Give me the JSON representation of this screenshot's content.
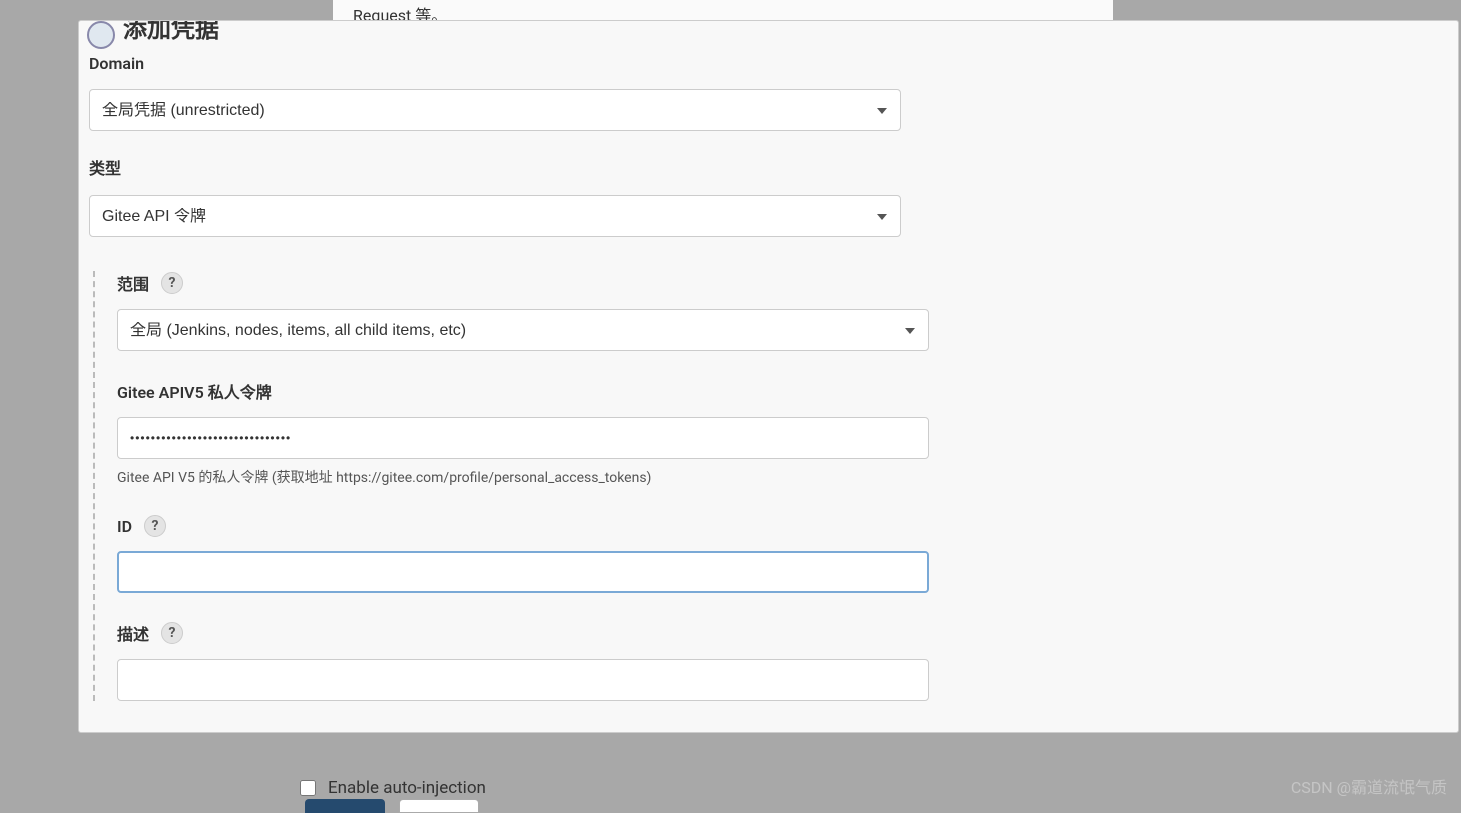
{
  "background": {
    "snippet_text": "Request 等。"
  },
  "modal": {
    "title": "添加凭据",
    "domain": {
      "label": "Domain",
      "value": "全局凭据 (unrestricted)"
    },
    "type": {
      "label": "类型",
      "value": "Gitee API 令牌"
    },
    "scope": {
      "label": "范围",
      "value": "全局 (Jenkins, nodes, items, all child items, etc)",
      "help": "?"
    },
    "token": {
      "label": "Gitee APIV5 私人令牌",
      "value": "•••••••••••••••••••••••••••••••",
      "help_text": "Gitee API V5 的私人令牌  (获取地址 https://gitee.com/profile/personal_access_tokens)"
    },
    "id_field": {
      "label": "ID",
      "value": "",
      "help": "?"
    },
    "description": {
      "label": "描述",
      "value": "",
      "help": "?"
    }
  },
  "bottom": {
    "checkbox_label": "Enable auto-injection"
  },
  "watermark": "CSDN @霸道流氓气质"
}
